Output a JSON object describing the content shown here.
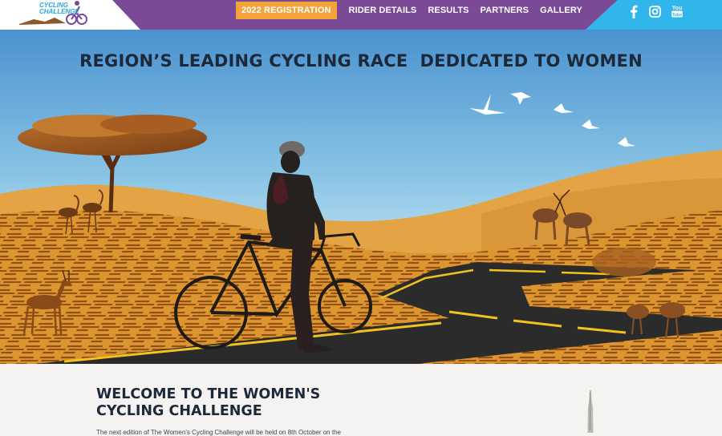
{
  "header": {
    "logo": {
      "text_line1": "CYCLING",
      "text_line2": "CHALLENGE"
    },
    "nav": [
      {
        "label": "2022 REGISTRATION",
        "active": true
      },
      {
        "label": "RIDER DETAILS",
        "active": false
      },
      {
        "label": "RESULTS",
        "active": false
      },
      {
        "label": "PARTNERS",
        "active": false
      },
      {
        "label": "GALLERY",
        "active": false
      }
    ],
    "social": [
      {
        "icon": "facebook-icon",
        "glyph": "f"
      },
      {
        "icon": "instagram-icon",
        "glyph": ""
      },
      {
        "icon": "youtube-icon",
        "glyph": "You"
      }
    ],
    "colors": {
      "purple": "#7a4a97",
      "blue": "#31b6ec",
      "accent": "#f2a43a"
    }
  },
  "hero": {
    "title": "REGION’S LEADING CYCLING RACE  DEDICATED TO WOMEN"
  },
  "welcome": {
    "title_line1": "WELCOME TO THE WOMEN'S",
    "title_line2": "CYCLING CHALLENGE",
    "body": "The next edition of The Women's Cycling Challenge will be held on 8th October on the"
  }
}
